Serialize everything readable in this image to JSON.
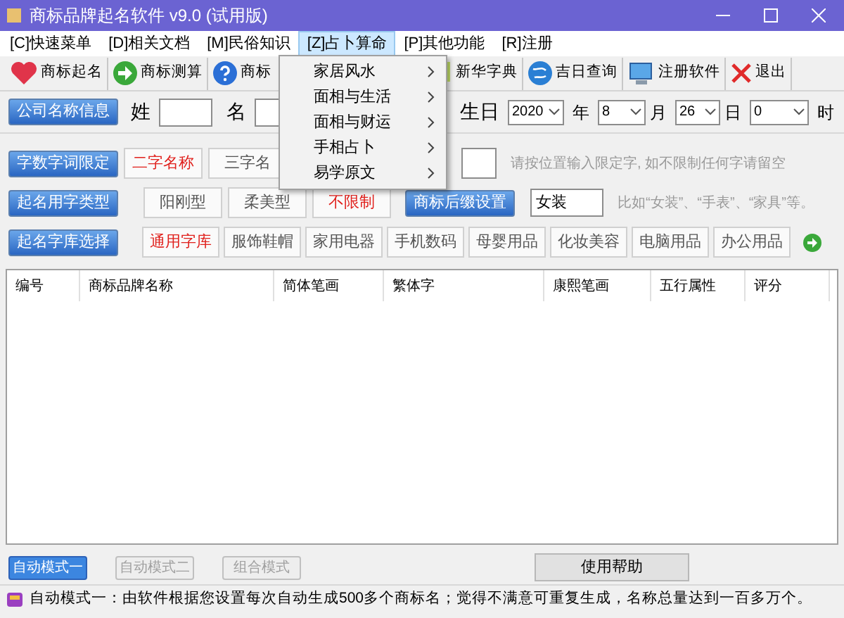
{
  "window": {
    "title": "商标品牌起名软件 v9.0 (试用版)"
  },
  "menu_bar": [
    {
      "label": "[C]快速菜单",
      "selected": false
    },
    {
      "label": "[D]相关文档",
      "selected": false
    },
    {
      "label": "[M]民俗知识",
      "selected": false
    },
    {
      "label": "[Z]占卜算命",
      "selected": true
    },
    {
      "label": "[P]其他功能",
      "selected": false
    },
    {
      "label": "[R]注册",
      "selected": false
    }
  ],
  "open_menu": {
    "items": [
      {
        "label": "家居风水"
      },
      {
        "label": "面相与生活"
      },
      {
        "label": "面相与财运"
      },
      {
        "label": "手相占卜"
      },
      {
        "label": "易学原文"
      }
    ]
  },
  "toolbar": [
    {
      "label": "商标起名",
      "kind": "heart"
    },
    {
      "label": "商标测算",
      "kind": "arrow"
    },
    {
      "label": "商标",
      "kind": "help"
    },
    {
      "label": "新华字典",
      "kind": "book"
    },
    {
      "label": "吉日查询",
      "kind": "globe"
    },
    {
      "label": "注册软件",
      "kind": "monitor"
    },
    {
      "label": "退出",
      "kind": "close"
    }
  ],
  "info_row": {
    "button": "公司名称信息",
    "surname_label": "姓",
    "given_label": "名",
    "birthday_label": "生日",
    "year": "2020",
    "year_unit": "年",
    "month": "8",
    "month_unit": "月",
    "day": "26",
    "day_unit": "日",
    "hour": "0",
    "hour_unit": "时"
  },
  "length_row": {
    "button": "字数字词限定",
    "options": [
      {
        "label": "二字名称",
        "selected": true
      },
      {
        "label": "三字名",
        "selected": false
      }
    ],
    "hint": "请按位置输入限定字, 如不限制任何字请留空"
  },
  "type_row": {
    "button": "起名用字类型",
    "options": [
      {
        "label": "阳刚型",
        "selected": false
      },
      {
        "label": "柔美型",
        "selected": false
      },
      {
        "label": "不限制",
        "selected": true
      }
    ],
    "suffix_button": "商标后缀设置",
    "suffix_value": "女装",
    "hint": "比如“女装”、“手表”、“家具”等。"
  },
  "library_row": {
    "button": "起名字库选择",
    "options": [
      {
        "label": "通用字库",
        "selected": true
      },
      {
        "label": "服饰鞋帽",
        "selected": false
      },
      {
        "label": "家用电器",
        "selected": false
      },
      {
        "label": "手机数码",
        "selected": false
      },
      {
        "label": "母婴用品",
        "selected": false
      },
      {
        "label": "化妆美容",
        "selected": false
      },
      {
        "label": "电脑用品",
        "selected": false
      },
      {
        "label": "办公用品",
        "selected": false
      }
    ]
  },
  "table": {
    "columns": [
      "编号",
      "商标品牌名称",
      "简体笔画",
      "繁体字",
      "康熙笔画",
      "五行属性",
      "评分"
    ]
  },
  "mode_tabs": [
    {
      "label": "自动模式一",
      "selected": true
    },
    {
      "label": "自动模式二",
      "selected": false
    },
    {
      "label": "组合模式",
      "selected": false
    }
  ],
  "help_button": "使用帮助",
  "status_bar": "自动模式一：由软件根据您设置每次自动生成500多个商标名；觉得不满意可重复生成，名称总量达到一百多万个。"
}
